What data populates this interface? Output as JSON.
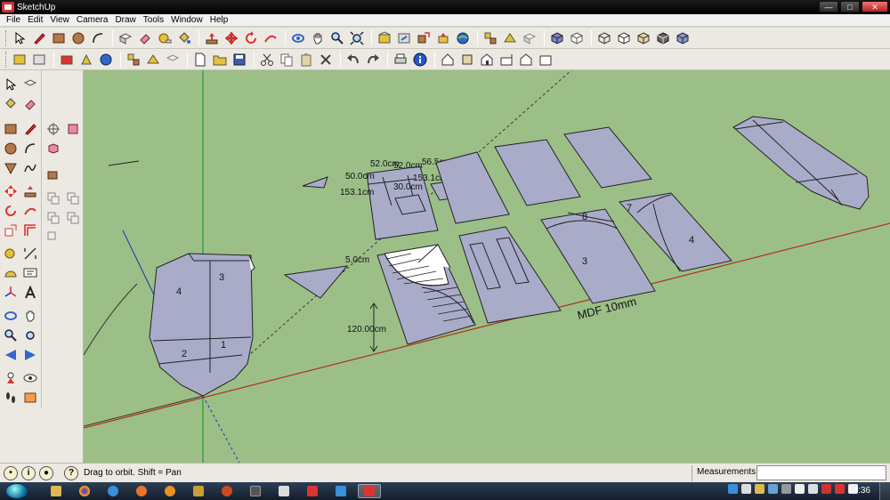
{
  "window": {
    "title": "SketchUp"
  },
  "menu": [
    "File",
    "Edit",
    "View",
    "Camera",
    "Draw",
    "Tools",
    "Window",
    "Help"
  ],
  "status": {
    "hint": "Drag to orbit.  Shift = Pan",
    "measurements_label": "Measurements",
    "measurements_value": ""
  },
  "taskbar": {
    "clock": "14:36"
  },
  "model": {
    "dimensions": [
      "52.0cm",
      "52.0cm",
      "56.5cm",
      "50.0cm",
      "153.1cm",
      "153.1cm",
      "30.0cm",
      "5.0cm",
      "120.00cm"
    ],
    "part_labels": [
      "3",
      "4",
      "2",
      "1",
      "8",
      "7",
      "3",
      "4"
    ],
    "material_label": "MDF 10mm"
  },
  "colors": {
    "viewport_bg": "#9cbf87",
    "face": "#a9acc9",
    "axis_red": "#b03020",
    "axis_green": "#2a9a2a",
    "axis_blue": "#2030b0"
  }
}
